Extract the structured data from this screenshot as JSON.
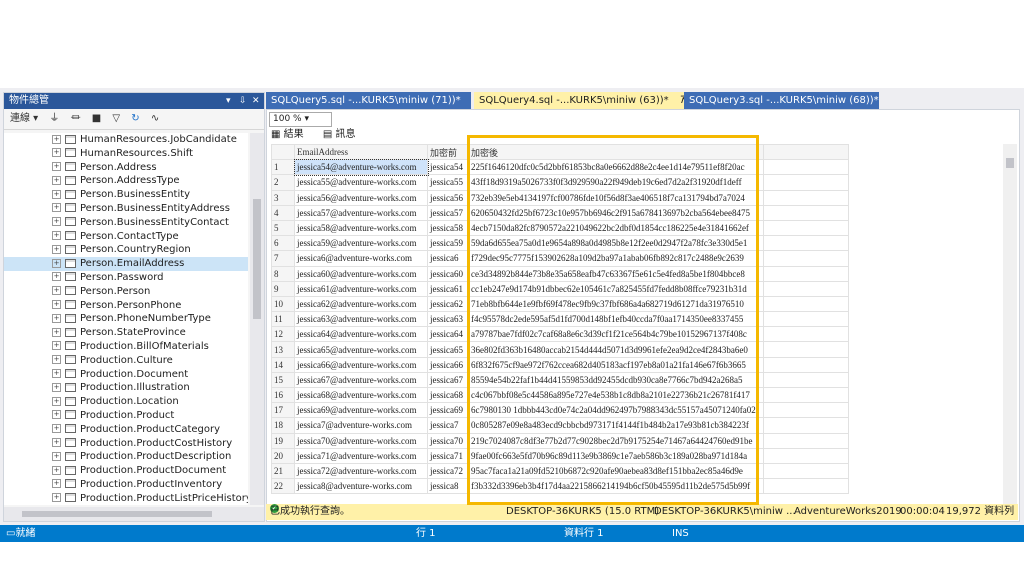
{
  "explorer": {
    "title": "物件總管",
    "controls": [
      "▾",
      "⇩",
      "✕"
    ],
    "toolbar": {
      "connect": "連線 ▾",
      "icons": [
        "plug-icon",
        "disconnect-icon",
        "stop-icon",
        "filter-icon",
        "refresh-icon",
        "activity-icon"
      ]
    },
    "items": [
      "HumanResources.JobCandidate",
      "HumanResources.Shift",
      "Person.Address",
      "Person.AddressType",
      "Person.BusinessEntity",
      "Person.BusinessEntityAddress",
      "Person.BusinessEntityContact",
      "Person.ContactType",
      "Person.CountryRegion",
      "Person.EmailAddress",
      "Person.Password",
      "Person.Person",
      "Person.PersonPhone",
      "Person.PhoneNumberType",
      "Person.StateProvince",
      "Production.BillOfMaterials",
      "Production.Culture",
      "Production.Document",
      "Production.Illustration",
      "Production.Location",
      "Production.Product",
      "Production.ProductCategory",
      "Production.ProductCostHistory",
      "Production.ProductDescription",
      "Production.ProductDocument",
      "Production.ProductInventory",
      "Production.ProductListPriceHistory"
    ],
    "selected_item": "Person.EmailAddress"
  },
  "tabs": [
    {
      "label": "SQLQuery5.sql -...KURK5\\miniw (71))*",
      "active": false
    },
    {
      "label": "SQLQuery4.sql -...KURK5\\miniw (63))*",
      "active": true
    },
    {
      "label": "SQLQuery3.sql -...KURK5\\miniw (68))*",
      "active": false
    }
  ],
  "query": {
    "zoom": "100 %",
    "result_tabs": [
      "結果",
      "訊息"
    ],
    "columns": [
      "",
      "EmailAddress",
      "加密前",
      "加密後"
    ],
    "rows": [
      [
        "1",
        "jessica54@adventure-works.com",
        "jessica54",
        "225f1646120dfc0c5d2bbf61853bc8a0e6662d88e2c4ee1d14e79511ef8f20ac"
      ],
      [
        "2",
        "jessica55@adventure-works.com",
        "jessica55",
        "43ff18d9319a5026733f0f3d929590a22f949deb19c6ed7d2a2f31920df1deff"
      ],
      [
        "3",
        "jessica56@adventure-works.com",
        "jessica56",
        "732eb39e5eb4134197fcf00786fde10f56d8f3ae406518f7ca131794bd7a7024"
      ],
      [
        "4",
        "jessica57@adventure-works.com",
        "jessica57",
        "620650432fd25bf6723c10e957bb6946c2f915a678413697b2cba564ebee8475"
      ],
      [
        "5",
        "jessica58@adventure-works.com",
        "jessica58",
        "4ecb7150da82fc8790572a221049622bc2dbf0d1854cc186225e4e31841662ef"
      ],
      [
        "6",
        "jessica59@adventure-works.com",
        "jessica59",
        "59da6d655ea75a0d1e9654a898a0d4985b8e12f2ee0d2947f2a78fc3e330d5e1"
      ],
      [
        "7",
        "jessica6@adventure-works.com",
        "jessica6",
        "f729dec95c7775f153902628a109d2ba97a1abab06fb892c817c2488e9c2639"
      ],
      [
        "8",
        "jessica60@adventure-works.com",
        "jessica60",
        "ce3d34892b844e73b8e35a658eafb47c63367f5e61c5e4fed8a5be1f804bbce8"
      ],
      [
        "9",
        "jessica61@adventure-works.com",
        "jessica61",
        "cc1eb247e9d174b91dbbec62e105461c7a825455fd7fedd8b08ffce79231b31d"
      ],
      [
        "10",
        "jessica62@adventure-works.com",
        "jessica62",
        "71eb8bfb644e1e9fbf69f478ec9fb9c37fbf686a4a682719d61271da31976510"
      ],
      [
        "11",
        "jessica63@adventure-works.com",
        "jessica63",
        "f4c95578dc2ede595af5d1fd700d148bf1efb40ccda7f0aa1714350ee8337455"
      ],
      [
        "12",
        "jessica64@adventure-works.com",
        "jessica64",
        "a79787bae7fdf02c7caf68a8e6c3d39cf1f21ce564b4c79be10152967137f408c"
      ],
      [
        "13",
        "jessica65@adventure-works.com",
        "jessica65",
        "36e802fd363b16480accab2154d444d5071d3d9961efe2ea9d2ce4f2843ba6e0"
      ],
      [
        "14",
        "jessica66@adventure-works.com",
        "jessica66",
        "6f832f675cf9ae972f762ccea682d405183acf197eb8a01a21fa146e67f6b3665"
      ],
      [
        "15",
        "jessica67@adventure-works.com",
        "jessica67",
        "85594e54b22faf1b44d41559853dd92455dcdb930ca8e7766c7bd942a268a5"
      ],
      [
        "16",
        "jessica68@adventure-works.com",
        "jessica68",
        "c4c067bbf08e5c44586a895e727e4e538b1c8db8a2101e22736b21c26781f417"
      ],
      [
        "17",
        "jessica69@adventure-works.com",
        "jessica69",
        "6c7980130 1dbbb443cd0e74c2a04dd962497b7988343dc55157a45071240fa02"
      ],
      [
        "18",
        "jessica7@adventure-works.com",
        "jessica7",
        "0c805287e09e8a483ecd9cbbcbd973171f4144f1b484b2a17e93b81cb384223f"
      ],
      [
        "19",
        "jessica70@adventure-works.com",
        "jessica70",
        "219c7024087c8df3e77b2d77c9028bec2d7b9175254e71467a64424760ed91be"
      ],
      [
        "20",
        "jessica71@adventure-works.com",
        "jessica71",
        "9fae00fc663e5fd70b96c89d113e9b3869c1e7aeb586b3c189a028ba971d184a"
      ],
      [
        "21",
        "jessica72@adventure-works.com",
        "jessica72",
        "95ac7faca1a21a09fd5210b6872c920afe90aebea83d8ef151bba2ec85a46d9e"
      ],
      [
        "22",
        "jessica8@adventure-works.com",
        "jessica8",
        "f3b332d3396eb3b4f17d4aa2215866214194b6cf50b45595d11b2de575d5b99f"
      ]
    ],
    "status": {
      "message": "已成功執行查詢。",
      "server": "DESKTOP-36KURK5 (15.0 RTM)",
      "user": "DESKTOP-36KURK5\\miniw ...",
      "database": "AdventureWorks2019",
      "time": "00:00:04",
      "rows": "19,972 資料列"
    }
  },
  "statusbar": {
    "ready": "就緒",
    "line": "行 1",
    "col": "資料行 1",
    "ins": "INS"
  },
  "colors": {
    "accent": "#007acc",
    "highlight_box": "#f5b800",
    "active_tab": "#fff1a8"
  }
}
